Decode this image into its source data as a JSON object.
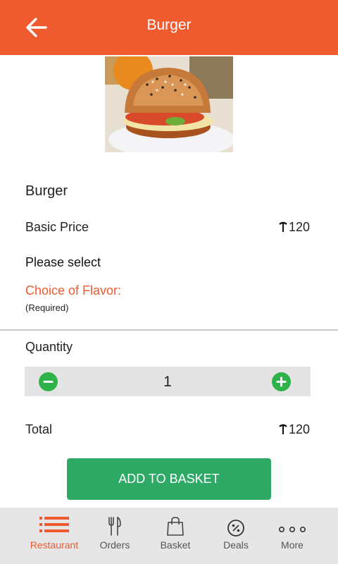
{
  "header": {
    "title": "Burger",
    "back_icon": "arrow-left-icon"
  },
  "item": {
    "name": "Burger",
    "price_label": "Basic Price",
    "price_value": "120",
    "currency_icon": "taka-icon"
  },
  "options": {
    "prompt": "Please select",
    "flavor_label": "Choice of Flavor:",
    "required_note": "(Required)"
  },
  "quantity": {
    "label": "Quantity",
    "value": "1",
    "decrement_icon": "minus-circle-icon",
    "increment_icon": "plus-circle-icon"
  },
  "total": {
    "label": "Total",
    "value": "120"
  },
  "actions": {
    "add_to_basket": "ADD TO BASKET"
  },
  "tabs": [
    {
      "label": "Restaurant",
      "icon": "list-icon",
      "active": true
    },
    {
      "label": "Orders",
      "icon": "fork-knife-icon",
      "active": false
    },
    {
      "label": "Basket",
      "icon": "shopping-bag-icon",
      "active": false
    },
    {
      "label": "Deals",
      "icon": "percent-icon",
      "active": false
    },
    {
      "label": "More",
      "icon": "more-dots-icon",
      "active": false
    }
  ],
  "colors": {
    "brand": "#ef5a2f",
    "accent_green": "#2eaa66",
    "qty_green": "#2fb24a"
  }
}
